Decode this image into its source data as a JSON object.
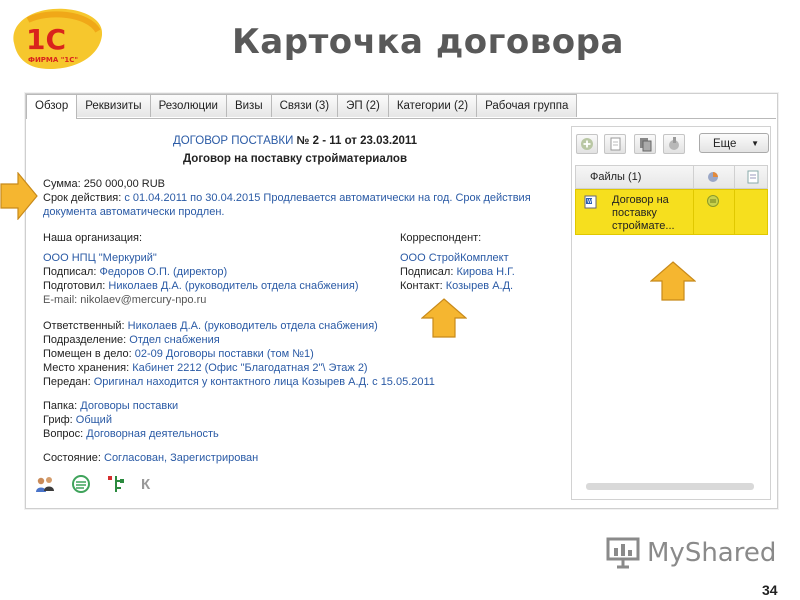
{
  "header": {
    "title": "Карточка договора",
    "logo_text": "1С",
    "logo_sub": "ФИРМА \"1С\""
  },
  "tabs": [
    {
      "label": "Обзор",
      "active": true
    },
    {
      "label": "Реквизиты"
    },
    {
      "label": "Резолюции"
    },
    {
      "label": "Визы"
    },
    {
      "label": "Связи (3)"
    },
    {
      "label": "ЭП (2)"
    },
    {
      "label": "Категории (2)"
    },
    {
      "label": "Рабочая группа"
    }
  ],
  "contract": {
    "heading_link": "ДОГОВОР ПОСТАВКИ",
    "heading_rest": " № 2 - 11 от 23.03.2011",
    "subject": "Договор на поставку стройматериалов",
    "sum_label": "Сумма: ",
    "sum_value": "250 000,00 RUB",
    "term_label": "Срок действия: ",
    "term_value_1": "с 01.04.2011 по 30.04.2015 Продлевается автоматически на год. Срок действия",
    "term_value_2": "документа автоматически продлен.",
    "our_org_label": "Наша организация:",
    "our_org": "ООО НПЦ \"Меркурий\"",
    "signed_label": "Подписал: ",
    "signed": "Федоров О.П. (директор)",
    "prepared_label": "Подготовил: ",
    "prepared": "Николаев Д.А. (руководитель отдела снабжения)",
    "email_label": "E-mail: ",
    "email": "nikolaev@mercury-npo.ru",
    "corr_label": "Корреспондент:",
    "corr": "ООО СтройКомплект",
    "corr_signed_label": "Подписал: ",
    "corr_signed": "Кирова Н.Г.",
    "contact_label": "Контакт: ",
    "contact": "Козырев А.Д.",
    "resp_label": "Ответственный: ",
    "resp": "Николаев Д.А. (руководитель отдела снабжения)",
    "dept_label": "Подразделение: ",
    "dept": "Отдел снабжения",
    "filed_label": "Помещен в дело: ",
    "filed": "02-09 Договоры поставки (том №1)",
    "storage_label": "Место хранения: ",
    "storage": "Кабинет 2212 (Офис \"Благодатная 2\"\\ Этаж 2)",
    "passed_label": "Передан: ",
    "passed": "Оригинал находится у контактного лица Козырев А.Д. с 15.05.2011",
    "folder_label": "Папка: ",
    "folder": "Договоры поставки",
    "grif_label": "Гриф: ",
    "grif": "Общий",
    "question_label": "Вопрос: ",
    "question": "Договорная деятельность",
    "state_label": "Состояние: ",
    "state": "Согласован, Зарегистрирован"
  },
  "bottom_icons": {
    "k_letter": "К"
  },
  "files": {
    "more_label": "Еще",
    "col_header": "Файлы (1)",
    "items": [
      {
        "name_1": "Договор на",
        "name_2": "поставку",
        "name_3": "строймате..."
      }
    ]
  },
  "footer": {
    "brand_my": "My",
    "brand_shared": "Shared",
    "page_number": "34"
  },
  "colors": {
    "link": "#2a5aa5",
    "selected_row": "#f6df1e",
    "arrow_fill": "#f5b630"
  }
}
